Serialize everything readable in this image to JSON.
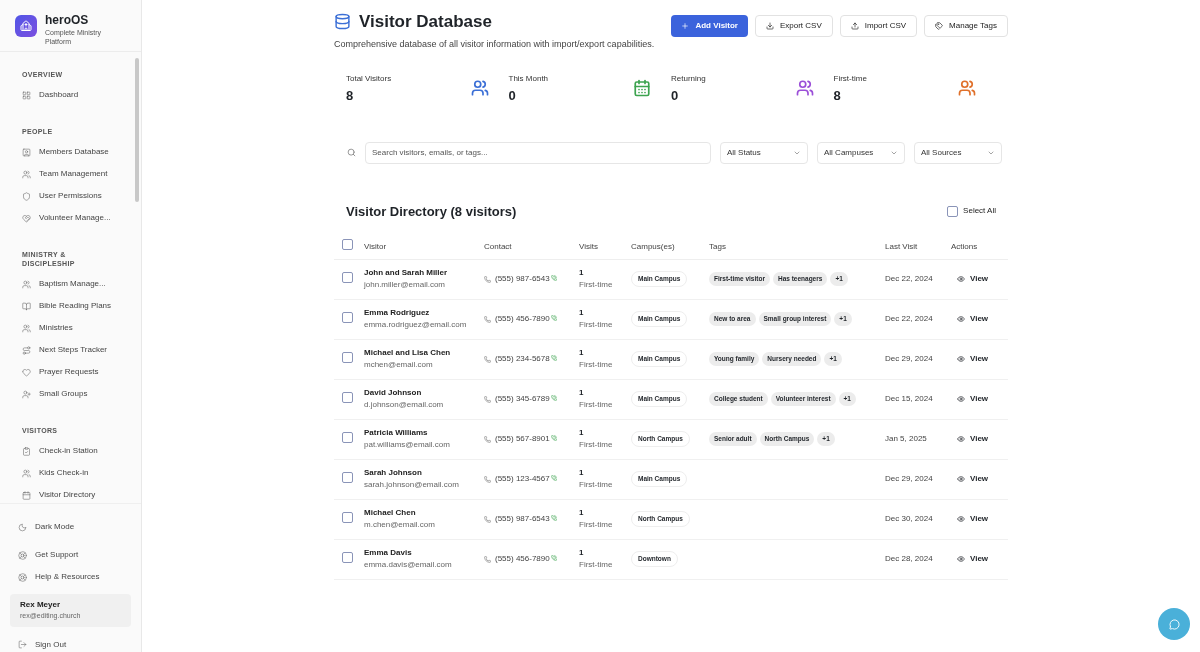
{
  "brand": {
    "name": "heroOS",
    "tagline": "Complete Ministry Platform"
  },
  "sidebar": {
    "sections": [
      {
        "title": "OVERVIEW",
        "items": [
          {
            "label": "Dashboard"
          }
        ]
      },
      {
        "title": "PEOPLE",
        "items": [
          {
            "label": "Members Database"
          },
          {
            "label": "Team Management"
          },
          {
            "label": "User Permissions"
          },
          {
            "label": "Volunteer Manage..."
          }
        ]
      },
      {
        "title": "MINISTRY & DISCIPLESHIP",
        "items": [
          {
            "label": "Baptism Manage..."
          },
          {
            "label": "Bible Reading Plans"
          },
          {
            "label": "Ministries"
          },
          {
            "label": "Next Steps Tracker"
          },
          {
            "label": "Prayer Requests"
          },
          {
            "label": "Small Groups"
          }
        ]
      },
      {
        "title": "VISITORS",
        "items": [
          {
            "label": "Check-in Station"
          },
          {
            "label": "Kids Check-in"
          },
          {
            "label": "Visitor Directory"
          }
        ]
      }
    ],
    "footer_items": [
      {
        "label": "Dark Mode"
      },
      {
        "label": "Get Support"
      },
      {
        "label": "Help & Resources"
      }
    ],
    "user": {
      "name": "Rex Meyer",
      "email": "rex@editing.church"
    },
    "sign_out": "Sign Out"
  },
  "page": {
    "title": "Visitor Database",
    "subtitle": "Comprehensive database of all visitor information with import/export capabilities."
  },
  "actions": [
    "Add Visitor",
    "Export CSV",
    "Import CSV",
    "Manage Tags"
  ],
  "stats": [
    {
      "label": "Total Visitors",
      "value": "8",
      "color": "#3b6fd6"
    },
    {
      "label": "This Month",
      "value": "0",
      "color": "#3da34f"
    },
    {
      "label": "Returning",
      "value": "0",
      "color": "#9b4fd8"
    },
    {
      "label": "First-time",
      "value": "8",
      "color": "#e0702a"
    }
  ],
  "search": {
    "placeholder": "Search visitors, emails, or tags..."
  },
  "filters": [
    "All Status",
    "All Campuses",
    "All Sources"
  ],
  "directory": {
    "title": "Visitor Directory (8 visitors)",
    "select_all": {
      "label": "Select All",
      "checked": false
    },
    "header_checked": false,
    "columns": [
      "Visitor",
      "Contact",
      "Visits",
      "Campus(es)",
      "Tags",
      "Last Visit",
      "Actions"
    ],
    "rows": [
      {
        "checked": false,
        "name": "John and Sarah Miller",
        "email": "john.miller@email.com",
        "phone": "(555) 987-6543",
        "visits": "1",
        "status": "First-time",
        "campus": "Main Campus",
        "tags": [
          "First-time visitor",
          "Has teenagers",
          "+1"
        ],
        "last_visit": "Dec 22, 2024",
        "action": "View"
      },
      {
        "checked": false,
        "name": "Emma Rodriguez",
        "email": "emma.rodriguez@email.com",
        "phone": "(555) 456-7890",
        "visits": "1",
        "status": "First-time",
        "campus": "Main Campus",
        "tags": [
          "New to area",
          "Small group interest",
          "+1"
        ],
        "last_visit": "Dec 22, 2024",
        "action": "View"
      },
      {
        "checked": false,
        "name": "Michael and Lisa Chen",
        "email": "mchen@email.com",
        "phone": "(555) 234-5678",
        "visits": "1",
        "status": "First-time",
        "campus": "Main Campus",
        "tags": [
          "Young family",
          "Nursery needed",
          "+1"
        ],
        "last_visit": "Dec 29, 2024",
        "action": "View"
      },
      {
        "checked": false,
        "name": "David Johnson",
        "email": "d.johnson@email.com",
        "phone": "(555) 345-6789",
        "visits": "1",
        "status": "First-time",
        "campus": "Main Campus",
        "tags": [
          "College student",
          "Volunteer interest",
          "+1"
        ],
        "last_visit": "Dec 15, 2024",
        "action": "View"
      },
      {
        "checked": false,
        "name": "Patricia Williams",
        "email": "pat.williams@email.com",
        "phone": "(555) 567-8901",
        "visits": "1",
        "status": "First-time",
        "campus": "North Campus",
        "tags": [
          "Senior adult",
          "North Campus",
          "+1"
        ],
        "last_visit": "Jan 5, 2025",
        "action": "View"
      },
      {
        "checked": false,
        "name": "Sarah Johnson",
        "email": "sarah.johnson@email.com",
        "phone": "(555) 123-4567",
        "visits": "1",
        "status": "First-time",
        "campus": "Main Campus",
        "last_visit": "Dec 29, 2024",
        "action": "View"
      },
      {
        "checked": false,
        "name": "Michael Chen",
        "email": "m.chen@email.com",
        "phone": "(555) 987-6543",
        "visits": "1",
        "status": "First-time",
        "campus": "North Campus",
        "last_visit": "Dec 30, 2024",
        "action": "View"
      },
      {
        "checked": false,
        "name": "Emma Davis",
        "email": "emma.davis@email.com",
        "phone": "(555) 456-7890",
        "visits": "1",
        "status": "First-time",
        "campus": "Downtown",
        "last_visit": "Dec 28, 2024",
        "action": "View"
      }
    ]
  }
}
